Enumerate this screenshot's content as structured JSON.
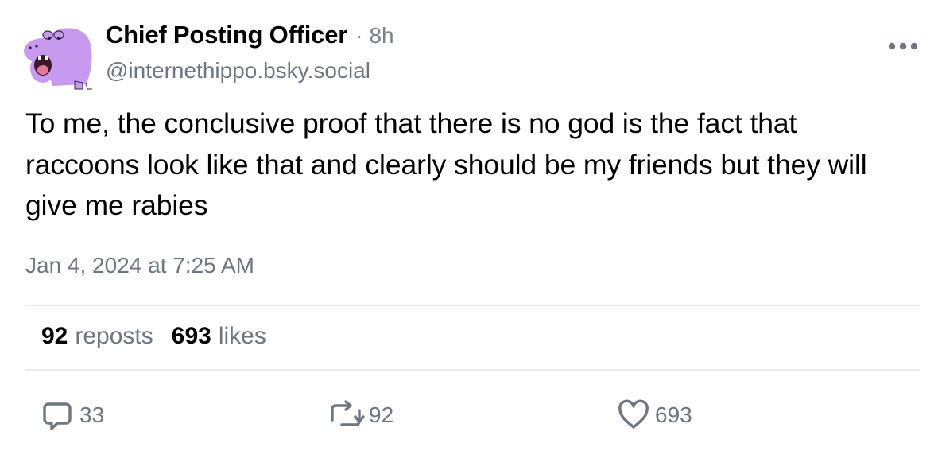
{
  "author": {
    "display_name": "Chief Posting Officer",
    "separator": "·",
    "time_ago": "8h",
    "handle": "@internethippo.bsky.social",
    "avatar_icon": "purple-hippo-avatar"
  },
  "post": {
    "text": "To me, the conclusive proof that there is no god is the fact that raccoons look like that and clearly should be my friends but they will give me rabies",
    "timestamp": "Jan 4, 2024 at 7:25 AM"
  },
  "stats": {
    "reposts_count": "92",
    "reposts_label": "reposts",
    "likes_count": "693",
    "likes_label": "likes"
  },
  "actions": {
    "reply": {
      "icon": "reply-icon",
      "count": "33"
    },
    "repost": {
      "icon": "repost-icon",
      "count": "92"
    },
    "like": {
      "icon": "heart-icon",
      "count": "693"
    },
    "more": {
      "icon": "more-icon"
    }
  },
  "colors": {
    "text_primary": "#000000",
    "text_secondary": "#6e7781",
    "divider": "#e8eaed",
    "avatar_purple": "#c79af0"
  }
}
